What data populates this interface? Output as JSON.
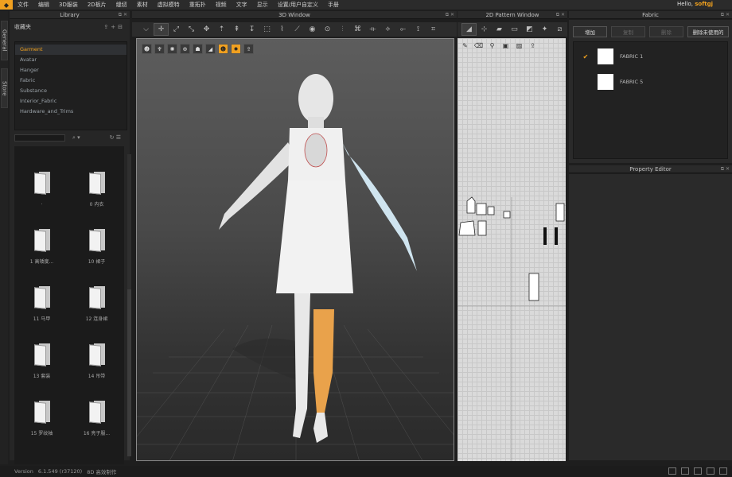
{
  "menubar": {
    "items": [
      "文件",
      "编辑",
      "3D服装",
      "2D板片",
      "缝纫",
      "素材",
      "虚拟模特",
      "重拓扑",
      "视频",
      "文字",
      "显示",
      "设置/用户自定义",
      "手册"
    ],
    "greeting": "Hello, ",
    "username": "softgj"
  },
  "side_tabs": [
    "General",
    "Store"
  ],
  "library": {
    "title": "Library",
    "favorites": "收藏夹",
    "tree": [
      "Garment",
      "Avatar",
      "Hanger",
      "Fabric",
      "Substance",
      "Interior_Fabric",
      "Hardware_and_Trims"
    ],
    "selected": "Garment",
    "files": [
      ".",
      "0 内衣",
      "1 高矮度...",
      "10 裙子",
      "11 马甲",
      "12 连身裙",
      "13 套装",
      "14 吊带",
      "15 罗纹袖",
      "16 亮子服..."
    ]
  },
  "view3d": {
    "title": "3D Window",
    "toolbar_icons": [
      "select-mesh-icon",
      "transform-icon",
      "pin-icon",
      "fold-arrangement-icon",
      "tack-icon",
      "strap-icon",
      "fold-icon",
      "measure-icon",
      "pattern-icon",
      "brush-icon",
      "needle-icon",
      "button-icon",
      "buttonhole-icon",
      "zipper-icon",
      "puckering-icon",
      "elastic-icon",
      "sewing-icon",
      "tape-icon",
      "camera-icon",
      "texture-icon"
    ],
    "viewport_tools": [
      "avatar-icon",
      "garment-icon",
      "simulation-icon",
      "texture-display-icon",
      "fabric-color-icon",
      "thickness-icon",
      "orange-avatar-icon",
      "orange-gear-icon",
      "export-icon"
    ]
  },
  "pattern_window": {
    "title": "2D Pattern Window"
  },
  "fabric": {
    "title": "Fabric",
    "buttons": [
      "增加",
      "复制",
      "删除",
      "删除未使用的"
    ],
    "items": [
      {
        "name": "FABRIC 1",
        "checked": true
      },
      {
        "name": "FABRIC 5",
        "checked": false
      }
    ]
  },
  "property_editor": {
    "title": "Property Editor"
  },
  "status": {
    "label": "Version",
    "value": "6.1.549 (r37120)",
    "extra": "8D 高效制作"
  }
}
